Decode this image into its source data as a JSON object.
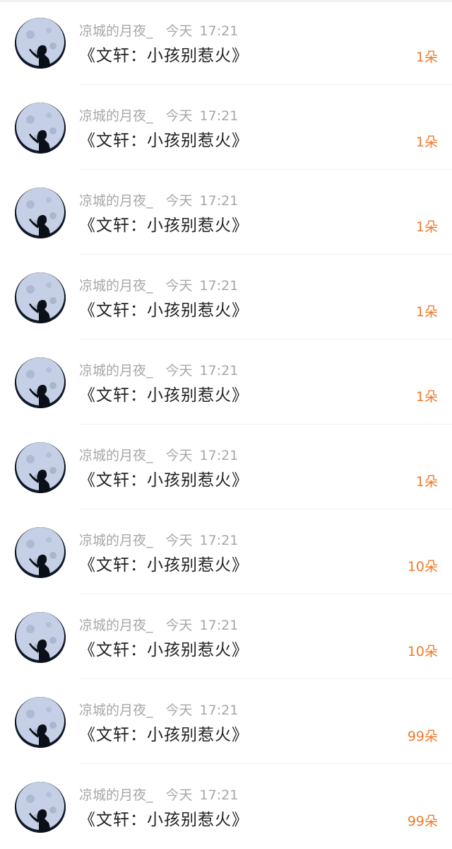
{
  "list": {
    "items": [
      {
        "username": "凉城的月夜_",
        "day": "今天",
        "time": "17:21",
        "title": "《文轩：小孩别惹火》",
        "gift": "1朵"
      },
      {
        "username": "凉城的月夜_",
        "day": "今天",
        "time": "17:21",
        "title": "《文轩：小孩别惹火》",
        "gift": "1朵"
      },
      {
        "username": "凉城的月夜_",
        "day": "今天",
        "time": "17:21",
        "title": "《文轩：小孩别惹火》",
        "gift": "1朵"
      },
      {
        "username": "凉城的月夜_",
        "day": "今天",
        "time": "17:21",
        "title": "《文轩：小孩别惹火》",
        "gift": "1朵"
      },
      {
        "username": "凉城的月夜_",
        "day": "今天",
        "time": "17:21",
        "title": "《文轩：小孩别惹火》",
        "gift": "1朵"
      },
      {
        "username": "凉城的月夜_",
        "day": "今天",
        "time": "17:21",
        "title": "《文轩：小孩别惹火》",
        "gift": "1朵"
      },
      {
        "username": "凉城的月夜_",
        "day": "今天",
        "time": "17:21",
        "title": "《文轩：小孩别惹火》",
        "gift": "10朵"
      },
      {
        "username": "凉城的月夜_",
        "day": "今天",
        "time": "17:21",
        "title": "《文轩：小孩别惹火》",
        "gift": "10朵"
      },
      {
        "username": "凉城的月夜_",
        "day": "今天",
        "time": "17:21",
        "title": "《文轩：小孩别惹火》",
        "gift": "99朵"
      },
      {
        "username": "凉城的月夜_",
        "day": "今天",
        "time": "17:21",
        "title": "《文轩：小孩别惹火》",
        "gift": "99朵"
      }
    ]
  },
  "avatar": {
    "icon": "moon-silhouette-avatar",
    "sky_color": "#101828",
    "moon_color": "#c5d0e6",
    "silhouette_color": "#0b0f18"
  },
  "colors": {
    "meta_text": "#a7a7a7",
    "title_text": "#222222",
    "gift_text": "#f07a2a",
    "divider": "#f0f0f0"
  }
}
